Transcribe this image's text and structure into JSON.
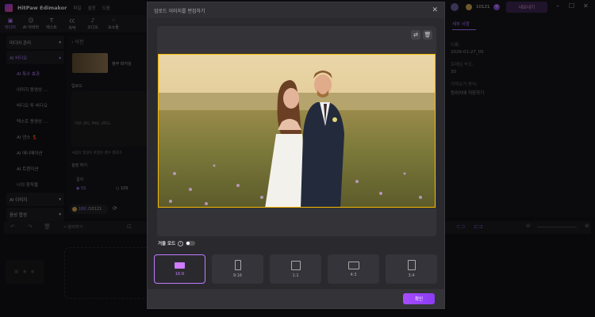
{
  "app": {
    "title": "HitPaw Edimakor",
    "menus": [
      "파일",
      "설정",
      "도움"
    ],
    "coins": "10121",
    "export_label": "내보내기"
  },
  "toolbar": [
    {
      "label": "미디어",
      "icon": "media-icon",
      "active": true
    },
    {
      "label": "AI 아바타",
      "icon": "avatar-icon"
    },
    {
      "label": "텍스트",
      "icon": "text-icon"
    },
    {
      "label": "자막",
      "icon": "caption-icon"
    },
    {
      "label": "오디오",
      "icon": "audio-icon"
    },
    {
      "label": "요소들",
      "icon": "elements-icon"
    }
  ],
  "sidebar": {
    "groups": [
      {
        "label": "미디어 관리"
      },
      {
        "label": "AI 비디오",
        "active": true
      }
    ],
    "items": [
      "AI 특수 효과",
      "이미지 동영상 ...",
      "비디오 투 비디오",
      "텍스트 동영상 ...",
      "AI 댄스 💃",
      "AI 애니메이션",
      "AI 트랜지션",
      "나의 창작물"
    ],
    "bottom_groups": [
      "AI 이미지",
      "음성 합성"
    ]
  },
  "middle": {
    "back_label": "이전",
    "effect_name": "정부 피어싱",
    "upload_label": "업로드",
    "formats": "지원: JPG, PNG, JPEG,",
    "hint": "사람의 얼굴이 포함된 경우 결과가",
    "settings_label": "설정 하기",
    "length_label": "길이",
    "opt5": "5S",
    "opt10": "10S",
    "credits_used": "160",
    "credits_total": "/10121"
  },
  "right_panel": {
    "tab": "세부 사항",
    "name_label": "이름:",
    "name_value": "2026-01-27_05",
    "fps_label": "프레임 속도:",
    "fps_value": "30",
    "import_label": "가져오기 방식:",
    "import_value": "원위치에 저장하기"
  },
  "timeline": {
    "split_label": "분리하기"
  },
  "modal": {
    "title": "업로드 이미지를 편집하기",
    "mirror_label": "거울 모드",
    "mirror_on": false,
    "ratios": [
      "16:9",
      "9:16",
      "1:1",
      "4:3",
      "3:4"
    ],
    "selected_ratio": "16:9",
    "confirm_label": "확인"
  },
  "colors": {
    "accent": "#a74cff",
    "crop_border": "#f5b800"
  }
}
